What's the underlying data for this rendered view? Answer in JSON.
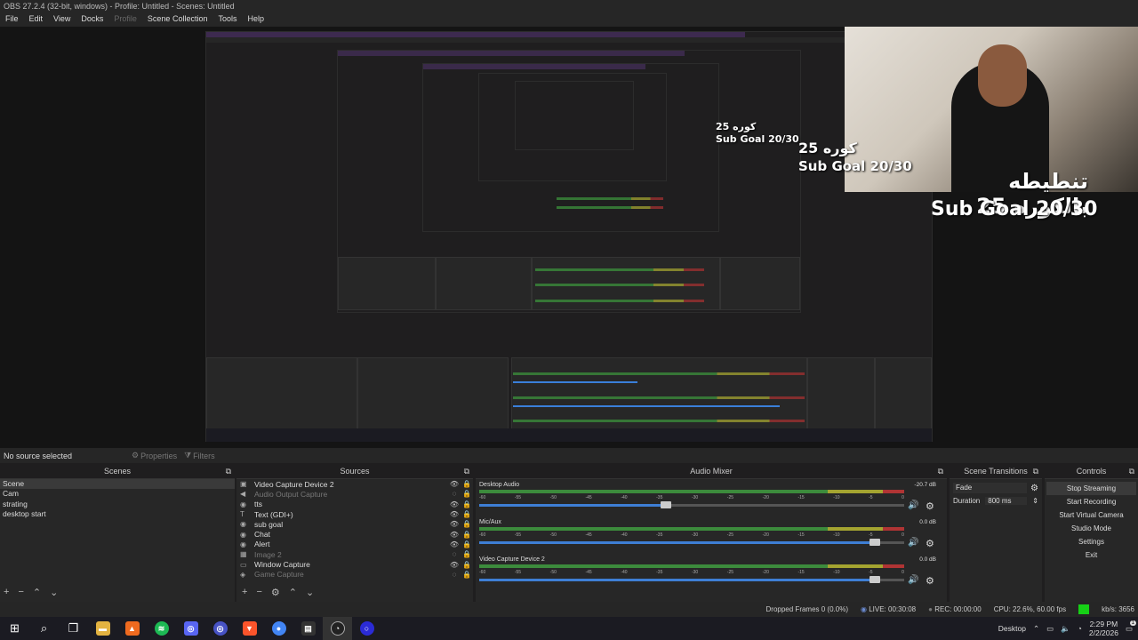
{
  "window": {
    "title": "OBS 27.2.4 (32-bit, windows) - Profile: Untitled - Scenes: Untitled"
  },
  "menu": [
    {
      "label": "File",
      "enabled": true
    },
    {
      "label": "Edit",
      "enabled": true
    },
    {
      "label": "View",
      "enabled": true
    },
    {
      "label": "Docks",
      "enabled": true
    },
    {
      "label": "Profile",
      "enabled": false
    },
    {
      "label": "Scene Collection",
      "enabled": true
    },
    {
      "label": "Tools",
      "enabled": true
    },
    {
      "label": "Help",
      "enabled": true
    }
  ],
  "overlay": {
    "arabic_text": "تنطيطه بالكوره 25",
    "sub_goal": "Sub Goal 20/30",
    "echo1_arabic": "كوره 25",
    "echo1_goal": "Sub Goal 20/30",
    "echo2_arabic": "25 كوره",
    "echo2_goal": "Sub Goal 20/30"
  },
  "status": {
    "no_source": "No source selected",
    "properties": "Properties",
    "filters": "Filters"
  },
  "docks": {
    "scenes_title": "Scenes",
    "sources_title": "Sources",
    "mixer_title": "Audio Mixer",
    "transitions_title": "Scene Transitions",
    "controls_title": "Controls"
  },
  "scenes": [
    "Scene",
    "Cam",
    "strating",
    "desktop start"
  ],
  "sources": [
    {
      "icon": "video-capture-icon",
      "glyph": "▣",
      "name": "Video Capture Device 2",
      "visible": true
    },
    {
      "icon": "speaker-icon",
      "glyph": "◀",
      "name": "Audio Output Capture",
      "visible": false
    },
    {
      "icon": "browser-icon",
      "glyph": "◉",
      "name": "tts",
      "visible": true
    },
    {
      "icon": "text-icon",
      "glyph": "T",
      "name": "Text (GDI+)",
      "visible": true
    },
    {
      "icon": "browser-icon",
      "glyph": "◉",
      "name": "sub goal",
      "visible": true
    },
    {
      "icon": "browser-icon",
      "glyph": "◉",
      "name": "Chat",
      "visible": true
    },
    {
      "icon": "browser-icon",
      "glyph": "◉",
      "name": "Alert",
      "visible": true
    },
    {
      "icon": "image-icon",
      "glyph": "▦",
      "name": "Image 2",
      "visible": false
    },
    {
      "icon": "window-capture-icon",
      "glyph": "▭",
      "name": "Window Capture",
      "visible": true
    },
    {
      "icon": "game-capture-icon",
      "glyph": "◈",
      "name": "Game Capture",
      "visible": false
    }
  ],
  "mixer": [
    {
      "name": "Desktop Audio",
      "db": "-20.7 dB",
      "volume": 0.44
    },
    {
      "name": "Mic/Aux",
      "db": "0.0 dB",
      "volume": 0.93
    },
    {
      "name": "Video Capture Device 2",
      "db": "0.0 dB",
      "volume": 0.93
    }
  ],
  "mixer_scale": [
    "-60",
    "-55",
    "-50",
    "-45",
    "-40",
    "-35",
    "-30",
    "-25",
    "-20",
    "-15",
    "-10",
    "-5",
    "0"
  ],
  "transitions": {
    "type": "Fade",
    "duration_label": "Duration",
    "duration_value": "800 ms"
  },
  "controls": [
    "Stop Streaming",
    "Start Recording",
    "Start Virtual Camera",
    "Studio Mode",
    "Settings",
    "Exit"
  ],
  "statusbar": {
    "dropped": "Dropped Frames 0 (0.0%)",
    "live": "LIVE: 00:30:08",
    "rec": "REC: 00:00:00",
    "cpu": "CPU: 22.6%, 60.00 fps",
    "kbps": "kb/s: 3656"
  },
  "taskbar": {
    "desktop_label": "Desktop",
    "time": "2:29 PM",
    "date": "2/2/2026",
    "notification_count": "1"
  }
}
